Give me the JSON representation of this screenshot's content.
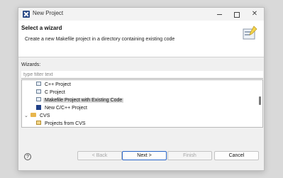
{
  "window": {
    "title": "New Project"
  },
  "header": {
    "title": "Select a wizard",
    "description": "Create a new Makefile project in a directory containing existing code"
  },
  "wizards": {
    "label": "Wizards:",
    "filter_placeholder": "type filter text",
    "items": [
      {
        "label": "C++ Project",
        "icon": "project-icon",
        "selected": false
      },
      {
        "label": "C Project",
        "icon": "project-icon",
        "selected": false
      },
      {
        "label": "Makefile Project with Existing Code",
        "icon": "project-icon",
        "selected": true
      },
      {
        "label": "New C/C++ Project",
        "icon": "new-project-icon",
        "selected": false
      },
      {
        "label": "CVS",
        "icon": "folder-icon",
        "expanded": true
      },
      {
        "label": "Projects from CVS",
        "icon": "cvs-icon",
        "selected": false
      }
    ]
  },
  "buttons": {
    "back": "< Back",
    "next": "Next >",
    "finish": "Finish",
    "cancel": "Cancel"
  },
  "colors": {
    "accent": "#2a66c8",
    "selection": "#d9d9d9",
    "background": "#f0f0f0"
  }
}
